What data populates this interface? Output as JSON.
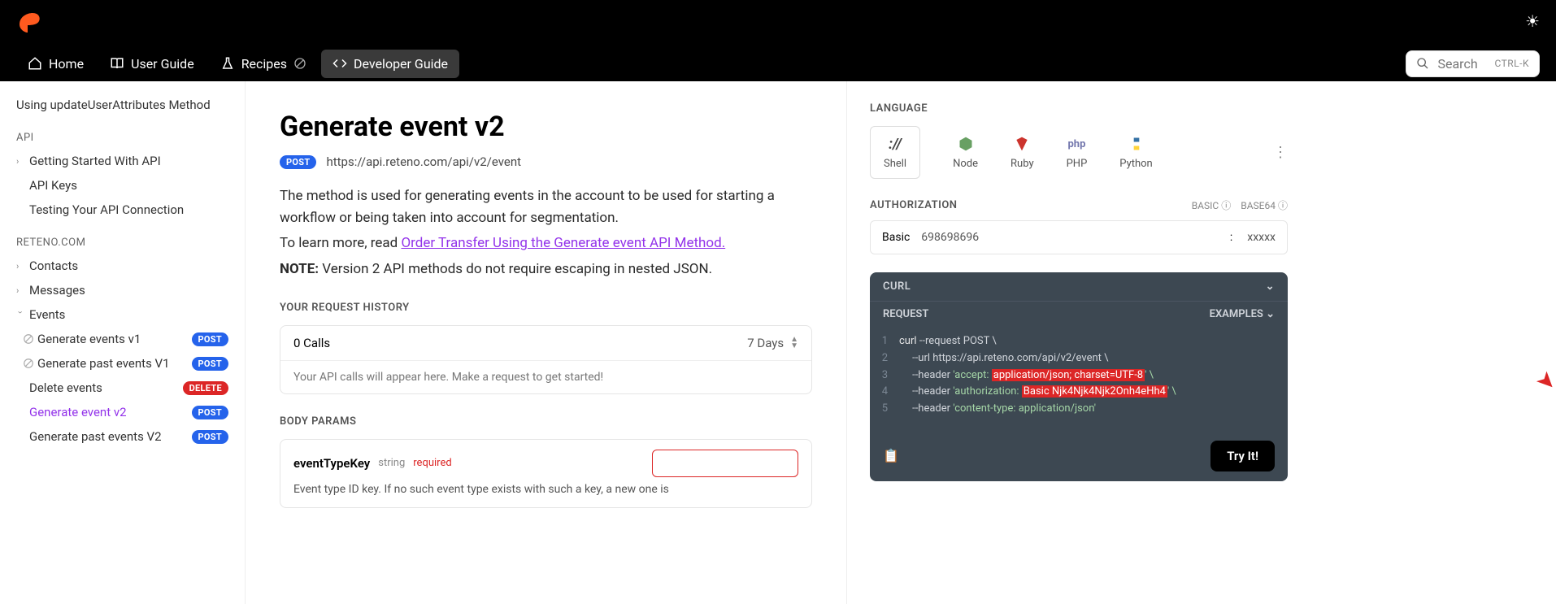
{
  "nav": {
    "home": "Home",
    "user_guide": "User Guide",
    "recipes": "Recipes",
    "developer_guide": "Developer Guide",
    "search_placeholder": "Search",
    "search_kbd": "CTRL-K"
  },
  "sidebar": {
    "item_update_attrs": "Using updateUserAttributes Method",
    "heading_api": "API",
    "item_getting_started": "Getting Started With API",
    "item_api_keys": "API Keys",
    "item_testing": "Testing Your API Connection",
    "heading_reteno": "RETENO.COM",
    "item_contacts": "Contacts",
    "item_messages": "Messages",
    "item_events": "Events",
    "item_gen_v1": "Generate events v1",
    "item_gen_past_v1": "Generate past events V1",
    "item_delete": "Delete events",
    "item_gen_v2": "Generate event v2",
    "item_gen_past_v2": "Generate past events V2",
    "badge_post": "POST",
    "badge_delete": "DELETE"
  },
  "content": {
    "title": "Generate event v2",
    "method_badge": "POST",
    "url": "https://api.reteno.com/api/v2/event",
    "desc1": "The method is used for generating events in the account to be used for starting a workflow or being taken into account for segmentation.",
    "desc2_prefix": "To learn more, read ",
    "desc2_link": "Order Transfer Using the Generate event API Method.",
    "note_label": "NOTE:",
    "note_text": " Version 2 API methods do not require escaping in nested JSON.",
    "history_heading": "YOUR REQUEST HISTORY",
    "history_calls": "0 Calls",
    "history_days": "7 Days",
    "history_msg": "Your API calls will appear here. Make a request to get started!",
    "body_params_heading": "BODY PARAMS",
    "param_name": "eventTypeKey",
    "param_type": "string",
    "param_required": "required",
    "param_desc": "Event type ID key. If no such event type exists with such a key, a new one is"
  },
  "rightpanel": {
    "language_heading": "LANGUAGE",
    "lang_shell": "Shell",
    "lang_node": "Node",
    "lang_ruby": "Ruby",
    "lang_php": "PHP",
    "lang_python": "Python",
    "auth_heading": "AUTHORIZATION",
    "auth_tag_basic": "BASIC",
    "auth_tag_base64": "BASE64",
    "auth_type": "Basic",
    "auth_user": "698698696",
    "auth_pass": "xxxxx",
    "code_curl": "CURL",
    "code_request": "REQUEST",
    "code_examples": "EXAMPLES",
    "tryit": "Try It!",
    "code": {
      "l1a": "curl ",
      "l1b": "--request POST \\",
      "l2a": "--url https://api.reteno.com/api/v2/event \\",
      "l3a": "--header ",
      "l3b": "'accept: ",
      "l3c": "application/json; charset=UTF-8",
      "l3d": "' \\",
      "l4a": "--header ",
      "l4b": "'authorization: ",
      "l4c": "Basic Njk4Njk4Njk2Onh4eHh4",
      "l4d": "' \\",
      "l5a": "--header ",
      "l5b": "'content-type: application/json'"
    }
  }
}
